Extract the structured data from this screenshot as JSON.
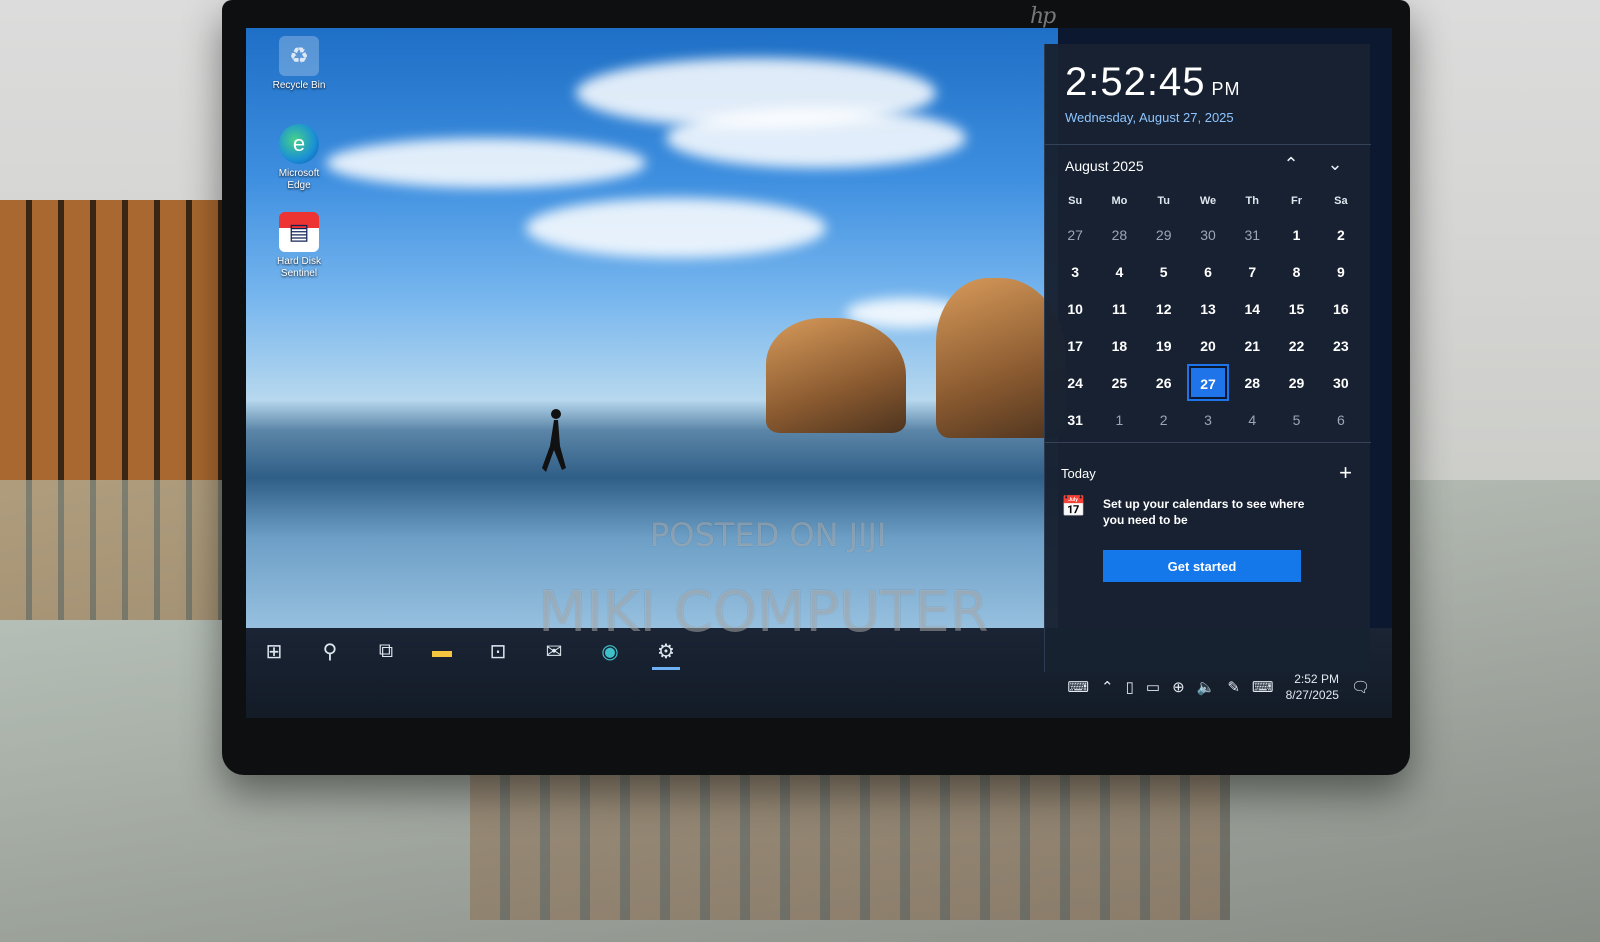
{
  "desktop": {
    "icons": [
      {
        "label": "Recycle Bin"
      },
      {
        "label": "Microsoft Edge"
      },
      {
        "label": "Hard Disk Sentinel"
      }
    ]
  },
  "flyout": {
    "time": "2:52:45",
    "ampm": "PM",
    "date": "Wednesday, August 27, 2025",
    "month": "August 2025",
    "weekdays": [
      "Su",
      "Mo",
      "Tu",
      "We",
      "Th",
      "Fr",
      "Sa"
    ],
    "weeks": [
      [
        "27",
        "28",
        "29",
        "30",
        "31",
        "1",
        "2"
      ],
      [
        "3",
        "4",
        "5",
        "6",
        "7",
        "8",
        "9"
      ],
      [
        "10",
        "11",
        "12",
        "13",
        "14",
        "15",
        "16"
      ],
      [
        "17",
        "18",
        "19",
        "20",
        "21",
        "22",
        "23"
      ],
      [
        "24",
        "25",
        "26",
        "27",
        "28",
        "29",
        "30"
      ],
      [
        "31",
        "1",
        "2",
        "3",
        "4",
        "5",
        "6"
      ]
    ],
    "today_label": "Today",
    "message": "Set up your calendars to see where you need to be",
    "button": "Get started"
  },
  "tray": {
    "time": "2:52 PM",
    "date": "8/27/2025"
  },
  "watermarks": {
    "top": "POSTED ON JIJI",
    "bottom": "MIKI COMPUTER"
  },
  "colors": {
    "accent": "#1e74e8",
    "flyout_bg": "#182232",
    "date_blue": "#8ec5ff"
  }
}
